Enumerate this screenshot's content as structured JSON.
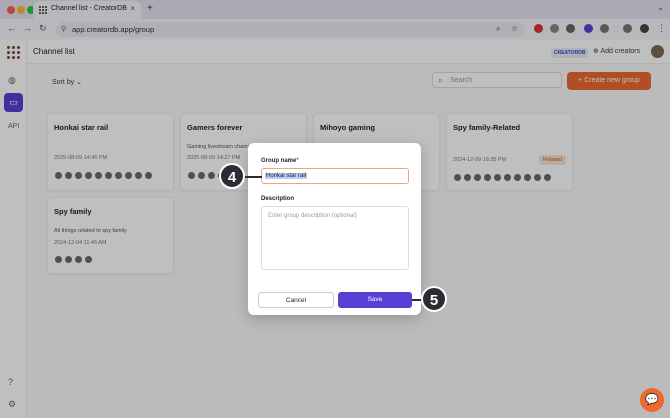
{
  "browser": {
    "tab_title": "Channel list - CreatorDB",
    "url": "app.creatordb.app/group"
  },
  "sidebar": {
    "api_label": "API"
  },
  "header": {
    "page_title": "Channel list",
    "badge": "CREATORDB",
    "add_creators": "Add creators"
  },
  "toolbar": {
    "sort_label": "Sort by",
    "search_placeholder": "Search",
    "new_group_label": "Create new group"
  },
  "cards": [
    {
      "title": "Honkai star rail",
      "description": "",
      "date": "2025-08-09 14:45 PM",
      "tag": ""
    },
    {
      "title": "Gamers forever",
      "description": "Gaming livestream channels",
      "date": "2025-08-09 14:27 PM",
      "tag": ""
    },
    {
      "title": "Mihoyo gaming",
      "description": "",
      "date": "",
      "tag": ""
    },
    {
      "title": "Spy family-Related",
      "description": "",
      "date": "2024-12-09 16:35 PM",
      "tag": "Related"
    },
    {
      "title": "Spy family",
      "description": "All things related to spy family",
      "date": "2024-12-04 11:46 AM",
      "tag": ""
    }
  ],
  "modal": {
    "group_name_label": "Group name",
    "required_mark": "*",
    "group_name_value": "Honkai star rail",
    "description_label": "Description",
    "description_placeholder": "Enter group description (optional)",
    "cancel_label": "Cancel",
    "save_label": "Save"
  },
  "steps": {
    "step4": "4",
    "step5": "5"
  }
}
